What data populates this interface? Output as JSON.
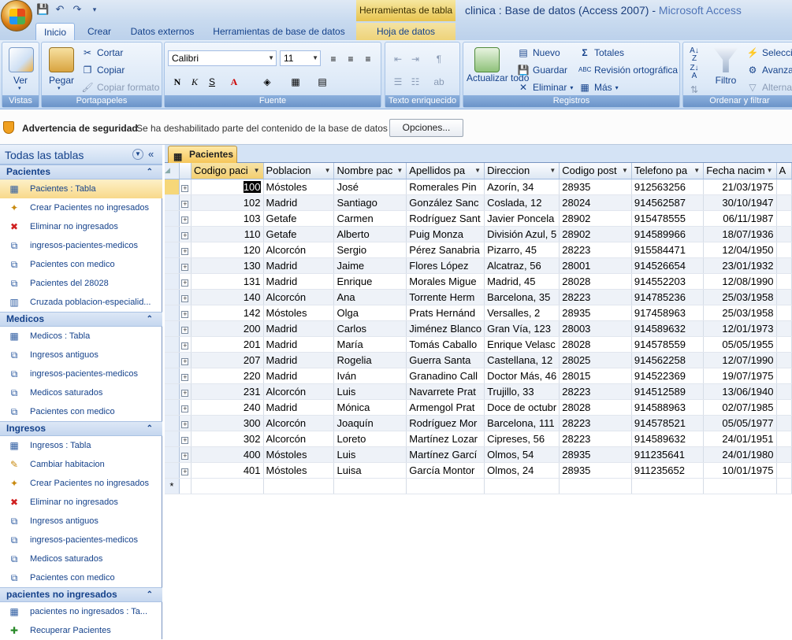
{
  "window": {
    "title_db": "clinica : Base de datos (Access 2007) - ",
    "title_app": "Microsoft Access",
    "context_group": "Herramientas de tabla"
  },
  "ribbon_tabs": [
    "Inicio",
    "Crear",
    "Datos externos",
    "Herramientas de base de datos",
    "Hoja de datos"
  ],
  "ribbon": {
    "vistas": {
      "label": "Vistas",
      "ver": "Ver"
    },
    "portapapeles": {
      "label": "Portapapeles",
      "pegar": "Pegar",
      "cortar": "Cortar",
      "copiar": "Copiar",
      "copiar_formato": "Copiar formato"
    },
    "fuente": {
      "label": "Fuente",
      "font": "Calibri",
      "size": "11"
    },
    "texto": {
      "label": "Texto enriquecido"
    },
    "registros": {
      "label": "Registros",
      "actualizar": "Actualizar todo",
      "nuevo": "Nuevo",
      "guardar": "Guardar",
      "eliminar": "Eliminar",
      "totales": "Totales",
      "revision": "Revisión ortográfica",
      "mas": "Más"
    },
    "ordenar": {
      "label": "Ordenar y filtrar",
      "filtro": "Filtro",
      "seleccion": "Selecció",
      "avanzadas": "Avanzad",
      "alternar": "Alternar"
    }
  },
  "security": {
    "title": "Advertencia de seguridad",
    "message": "Se ha deshabilitado parte del contenido de la base de datos",
    "options": "Opciones..."
  },
  "nav": {
    "title": "Todas las tablas",
    "groups": [
      {
        "name": "Pacientes",
        "items": [
          {
            "label": "Pacientes : Tabla",
            "icon": "table-icon"
          },
          {
            "label": "Crear Pacientes no ingresados",
            "icon": "make-table-query-icon"
          },
          {
            "label": "Eliminar no ingresados",
            "icon": "delete-query-icon"
          },
          {
            "label": "ingresos-pacientes-medicos",
            "icon": "query-icon"
          },
          {
            "label": "Pacientes con medico",
            "icon": "query-icon"
          },
          {
            "label": "Pacientes del 28028",
            "icon": "query-icon"
          },
          {
            "label": "Cruzada poblacion-especialid...",
            "icon": "crosstab-query-icon"
          }
        ]
      },
      {
        "name": "Medicos",
        "items": [
          {
            "label": "Medicos : Tabla",
            "icon": "table-icon"
          },
          {
            "label": "Ingresos antiguos",
            "icon": "query-icon"
          },
          {
            "label": "ingresos-pacientes-medicos",
            "icon": "query-icon"
          },
          {
            "label": "Medicos saturados",
            "icon": "query-icon"
          },
          {
            "label": "Pacientes con medico",
            "icon": "query-icon"
          }
        ]
      },
      {
        "name": "Ingresos",
        "items": [
          {
            "label": "Ingresos : Tabla",
            "icon": "table-icon"
          },
          {
            "label": "Cambiar habitacion",
            "icon": "update-query-icon"
          },
          {
            "label": "Crear Pacientes no ingresados",
            "icon": "make-table-query-icon"
          },
          {
            "label": "Eliminar no ingresados",
            "icon": "delete-query-icon"
          },
          {
            "label": "Ingresos antiguos",
            "icon": "query-icon"
          },
          {
            "label": "ingresos-pacientes-medicos",
            "icon": "query-icon"
          },
          {
            "label": "Medicos saturados",
            "icon": "query-icon"
          },
          {
            "label": "Pacientes con medico",
            "icon": "query-icon"
          }
        ]
      },
      {
        "name": "pacientes no ingresados",
        "items": [
          {
            "label": "pacientes no ingresados : Ta...",
            "icon": "table-icon"
          },
          {
            "label": "Recuperar Pacientes",
            "icon": "append-query-icon"
          }
        ]
      }
    ]
  },
  "doc_tab": "Pacientes",
  "columns": [
    "Codigo paci",
    "Poblacion",
    "Nombre pac",
    "Apellidos pa",
    "Direccion",
    "Codigo post",
    "Telefono pa",
    "Fecha nacim",
    "A"
  ],
  "rows": [
    [
      "100",
      "Móstoles",
      "José",
      "Romerales Pin",
      "Azorín, 34",
      "28935",
      "912563256",
      "21/03/1975"
    ],
    [
      "102",
      "Madrid",
      "Santiago",
      "González Sanc",
      "Coslada, 12",
      "28024",
      "914562587",
      "30/10/1947"
    ],
    [
      "103",
      "Getafe",
      "Carmen",
      "Rodríguez Sant",
      "Javier Poncela",
      "28902",
      "915478555",
      "06/11/1987"
    ],
    [
      "110",
      "Getafe",
      "Alberto",
      "Puig Monza",
      "División Azul, 5",
      "28902",
      "914589966",
      "18/07/1936"
    ],
    [
      "120",
      "Alcorcón",
      "Sergio",
      "Pérez Sanabria",
      "Pizarro, 45",
      "28223",
      "915584471",
      "12/04/1950"
    ],
    [
      "130",
      "Madrid",
      "Jaime",
      "Flores López",
      "Alcatraz, 56",
      "28001",
      "914526654",
      "23/01/1932"
    ],
    [
      "131",
      "Madrid",
      "Enrique",
      "Morales Migue",
      "Madrid, 45",
      "28028",
      "914552203",
      "12/08/1990"
    ],
    [
      "140",
      "Alcorcón",
      "Ana",
      "Torrente Herm",
      "Barcelona, 35",
      "28223",
      "914785236",
      "25/03/1958"
    ],
    [
      "142",
      "Móstoles",
      "Olga",
      "Prats Hernánd",
      "Versalles, 2",
      "28935",
      "917458963",
      "25/03/1958"
    ],
    [
      "200",
      "Madrid",
      "Carlos",
      "Jiménez Blanco",
      "Gran Vía, 123",
      "28003",
      "914589632",
      "12/01/1973"
    ],
    [
      "201",
      "Madrid",
      "María",
      "Tomás Caballo",
      "Enrique Velasc",
      "28028",
      "914578559",
      "05/05/1955"
    ],
    [
      "207",
      "Madrid",
      "Rogelia",
      "Guerra Santa",
      "Castellana, 12",
      "28025",
      "914562258",
      "12/07/1990"
    ],
    [
      "220",
      "Madrid",
      "Iván",
      "Granadino Call",
      "Doctor Más, 46",
      "28015",
      "914522369",
      "19/07/1975"
    ],
    [
      "231",
      "Alcorcón",
      "Luis",
      "Navarrete Prat",
      "Trujillo, 33",
      "28223",
      "914512589",
      "13/06/1940"
    ],
    [
      "240",
      "Madrid",
      "Mónica",
      "Armengol Prat",
      "Doce de octubr",
      "28028",
      "914588963",
      "02/07/1985"
    ],
    [
      "300",
      "Alcorcón",
      "Joaquín",
      "Rodríguez Mor",
      "Barcelona, 111",
      "28223",
      "914578521",
      "05/05/1977"
    ],
    [
      "302",
      "Alcorcón",
      "Loreto",
      "Martínez Lozar",
      "Cipreses, 56",
      "28223",
      "914589632",
      "24/01/1951"
    ],
    [
      "400",
      "Móstoles",
      "Luis",
      "Martínez Garcí",
      "Olmos, 54",
      "28935",
      "911235641",
      "24/01/1980"
    ],
    [
      "401",
      "Móstoles",
      "Luisa",
      "García Montor",
      "Olmos, 24",
      "28935",
      "911235652",
      "10/01/1975"
    ]
  ],
  "new_row_marker": "*"
}
